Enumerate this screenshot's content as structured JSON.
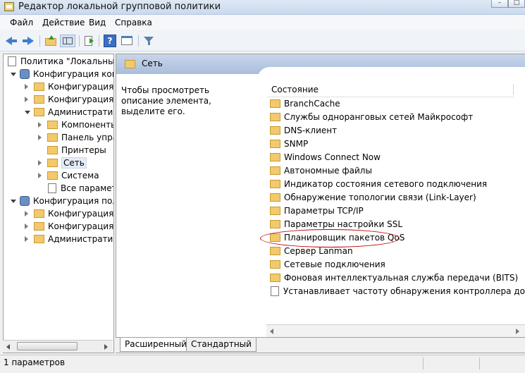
{
  "window": {
    "title": "Редактор локальной групповой политики",
    "buttons": [
      "–",
      "□"
    ]
  },
  "menu": [
    "Файл",
    "Действие",
    "Вид",
    "Справка"
  ],
  "toolbar_icons": [
    "back-icon",
    "forward-icon",
    "up-folder-icon",
    "show-tree-icon",
    "export-list-icon",
    "help-icon",
    "properties-icon",
    "filter-icon"
  ],
  "tree": {
    "root": "Политика \"Локальный",
    "computer_config": "Конфигурация комп",
    "computer_children": [
      "Конфигурация п",
      "Конфигурация W",
      "Административ"
    ],
    "admin_children": [
      "Компоненты",
      "Панель упра",
      "Принтеры",
      "Сеть",
      "Система",
      "Все параметр"
    ],
    "user_config": "Конфигурация поль",
    "user_children": [
      "Конфигурация п",
      "Конфигурация W",
      "Административ"
    ]
  },
  "right": {
    "header": "Сеть",
    "description": "Чтобы просмотреть описание элемента, выделите его.",
    "column": "Состояние",
    "items": [
      "BranchCache",
      "Службы одноранговых сетей Майкрософт",
      "DNS-клиент",
      "SNMP",
      "Windows Connect Now",
      "Автономные файлы",
      "Индикатор состояния сетевого подключения",
      "Обнаружение топологии связи (Link-Layer)",
      "Параметры TCP/IP",
      "Параметры настройки SSL",
      "Планировщик пакетов QoS",
      "Сервер Lanman",
      "Сетевые подключения",
      "Фоновая интеллектуальная служба передачи (BITS)",
      "Устанавливает частоту обнаружения контроллера домен..."
    ]
  },
  "tabs": [
    "Расширенный",
    "Стандартный"
  ],
  "status": "1 параметров",
  "colors": {
    "folder": "#f2c96b",
    "header": "#b7c8e3",
    "highlight": "#c00000"
  }
}
